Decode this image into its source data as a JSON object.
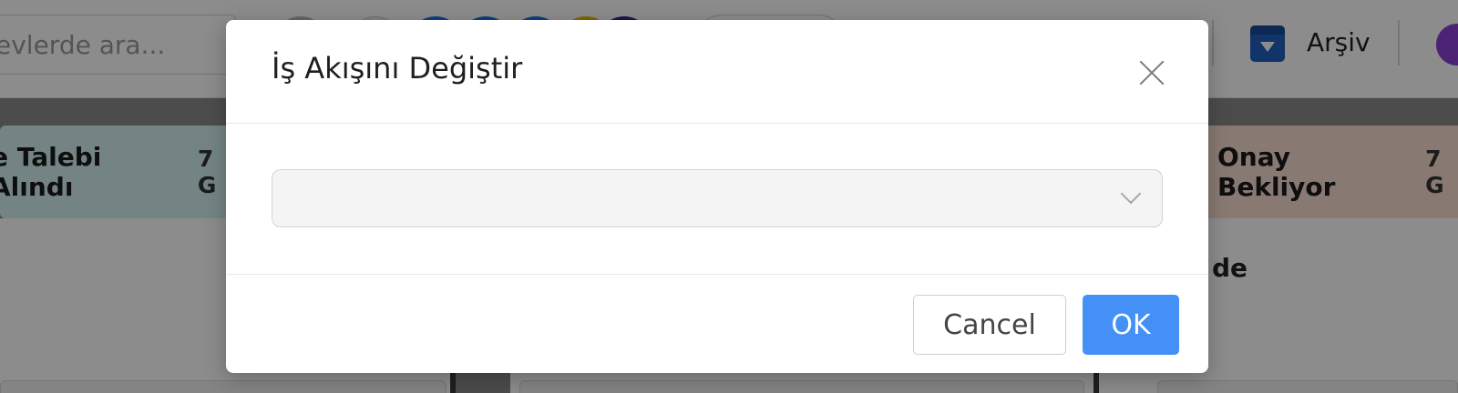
{
  "background": {
    "search": {
      "placeholder_visible": "evlerde ara..."
    },
    "avatars": [
      {
        "color": "#b8b8b8"
      },
      {
        "color": "#ededed"
      },
      {
        "color": "#1e73e0"
      },
      {
        "color": "#1e73e0"
      },
      {
        "color": "#1e73e0"
      },
      {
        "color": "#e6b800"
      },
      {
        "color": "#2f2a8c"
      }
    ],
    "toolbar": {
      "archive_label": "Arşiv"
    },
    "columns": [
      {
        "title": "e Talebi Alındı",
        "count": "7 G",
        "color": "#d4f0f2"
      },
      {
        "title": "Onay Bekliyor",
        "count": "7 G",
        "color": "#f9ddd2"
      }
    ],
    "card_text": "de"
  },
  "modal": {
    "title": "İş Akışını Değiştir",
    "select": {
      "value": ""
    },
    "buttons": {
      "cancel": "Cancel",
      "ok": "OK"
    },
    "accent_color": "#4391f7"
  }
}
